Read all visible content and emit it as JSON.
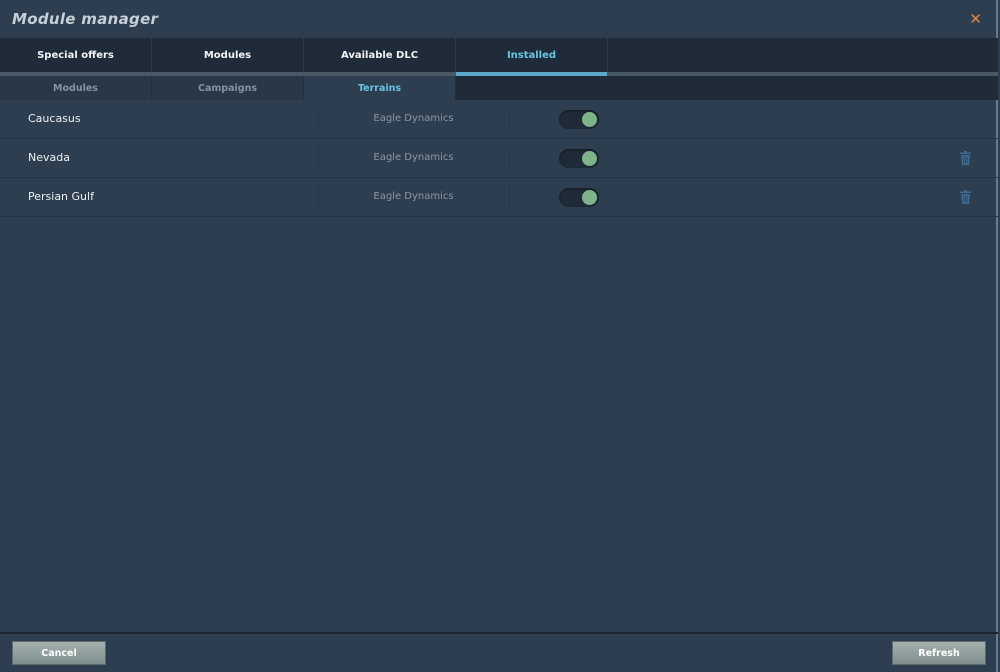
{
  "window": {
    "title": "Module manager",
    "close_icon": "close-icon"
  },
  "tabs": [
    {
      "label": "Special offers"
    },
    {
      "label": "Modules"
    },
    {
      "label": "Available DLC"
    },
    {
      "label": "Installed",
      "active": true
    }
  ],
  "subtabs": [
    {
      "label": "Modules"
    },
    {
      "label": "Campaigns"
    },
    {
      "label": "Terrains",
      "active": true
    }
  ],
  "rows": [
    {
      "name": "Caucasus",
      "publisher": "Eagle Dynamics",
      "enabled": true,
      "deletable": false
    },
    {
      "name": "Nevada",
      "publisher": "Eagle Dynamics",
      "enabled": true,
      "deletable": true
    },
    {
      "name": "Persian Gulf",
      "publisher": "Eagle Dynamics",
      "enabled": true,
      "deletable": true
    }
  ],
  "footer": {
    "cancel": "Cancel",
    "refresh": "Refresh"
  },
  "colors": {
    "accent": "#6cc4e4",
    "toggle_on": "#7fb48a",
    "close": "#d98a4a"
  }
}
